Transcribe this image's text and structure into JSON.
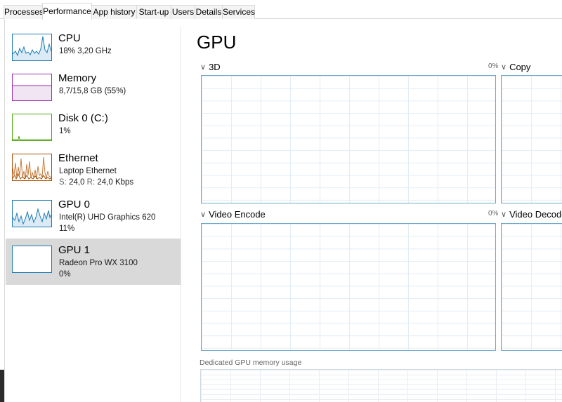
{
  "tabs": [
    {
      "label": "Processes",
      "active": false
    },
    {
      "label": "Performance",
      "active": true
    },
    {
      "label": "App history",
      "active": false
    },
    {
      "label": "Start-up",
      "active": false
    },
    {
      "label": "Users",
      "active": false
    },
    {
      "label": "Details",
      "active": false
    },
    {
      "label": "Services",
      "active": false
    }
  ],
  "sidebar": {
    "items": [
      {
        "title": "CPU",
        "lines": [
          "18%  3,20 GHz"
        ],
        "color": "#1b7cb5",
        "icon": "cpu-graph"
      },
      {
        "title": "Memory",
        "lines": [
          "8,7/15,8 GB (55%)"
        ],
        "color": "#9b2fae",
        "icon": "memory-graph"
      },
      {
        "title": "Disk 0 (C:)",
        "lines": [
          "1%"
        ],
        "color": "#4da60c",
        "icon": "disk-graph"
      },
      {
        "title": "Ethernet",
        "lines": [
          "Laptop Ethernet"
        ],
        "send_label": "S:",
        "send_value": "24,0",
        "recv_label": "R:",
        "recv_value": "24,0 Kbps",
        "color": "#a74f01",
        "icon": "ethernet-graph"
      },
      {
        "title": "GPU 0",
        "lines": [
          "Intel(R) UHD Graphics 620",
          "11%"
        ],
        "color": "#1b7cb5",
        "icon": "gpu-graph"
      },
      {
        "title": "GPU 1",
        "lines": [
          "Radeon Pro WX 3100",
          "0%"
        ],
        "color": "#1b7cb5",
        "icon": "gpu-graph",
        "selected": true
      }
    ]
  },
  "main": {
    "title": "GPU",
    "engines": [
      {
        "label": "3D",
        "percent": "0%"
      },
      {
        "label": "Copy",
        "percent": ""
      },
      {
        "label": "Video Encode",
        "percent": "0%"
      },
      {
        "label": "Video Decode",
        "percent": ""
      }
    ],
    "memory_label": "Dedicated GPU memory usage"
  },
  "colors": {
    "graph_border": "#6fa5c8",
    "graph_grid": "#e2edf5",
    "selected_bg": "#d9d9d9"
  }
}
